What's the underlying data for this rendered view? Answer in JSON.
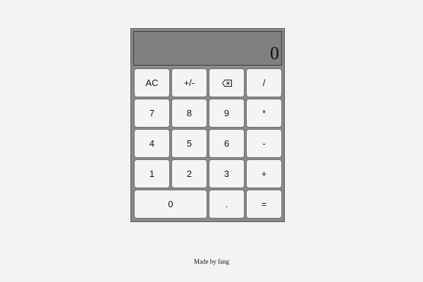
{
  "display": {
    "value": "0"
  },
  "keys": {
    "clear": "AC",
    "negate": "+/-",
    "backspace_icon": "backspace-icon",
    "divide": "/",
    "seven": "7",
    "eight": "8",
    "nine": "9",
    "multiply": "*",
    "four": "4",
    "five": "5",
    "six": "6",
    "subtract": "-",
    "one": "1",
    "two": "2",
    "three": "3",
    "add": "+",
    "zero": "0",
    "decimal": ".",
    "equals": "="
  },
  "footer": {
    "credit": "Made by fang"
  },
  "colors": {
    "page_background": "#f3f3f3",
    "calculator_body": "#8a8a8a",
    "display_background": "#808080",
    "key_background": "#f4f4f4"
  }
}
